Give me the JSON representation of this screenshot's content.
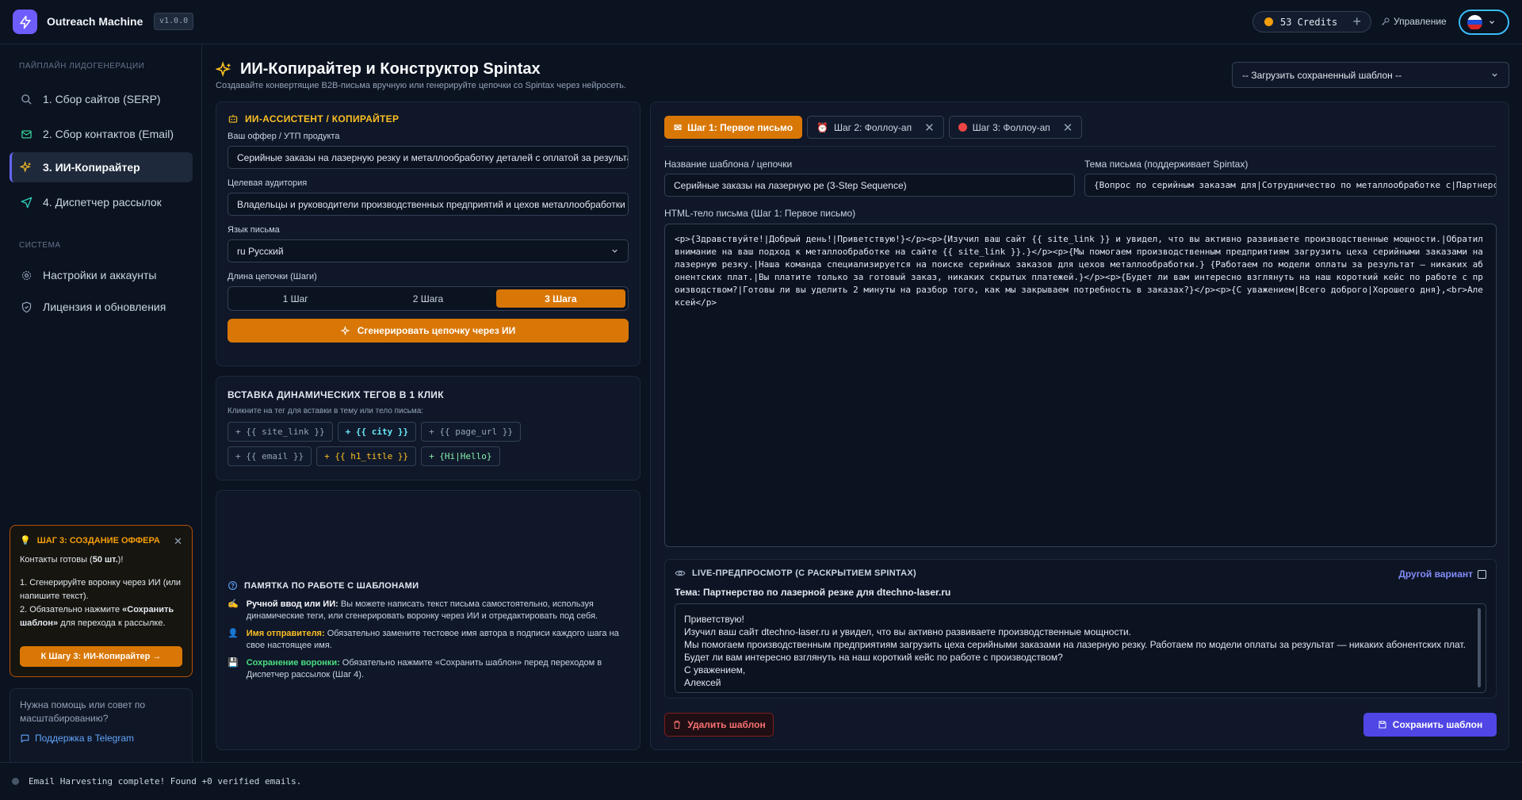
{
  "header": {
    "app_name": "Outreach Machine",
    "version": "v1.0.0",
    "credits": "53 Credits",
    "manage": "Управление",
    "language_flag": "ru"
  },
  "sidebar": {
    "section_pipeline": "ПАЙПЛАЙН ЛИДОГЕНЕРАЦИИ",
    "items": [
      {
        "label": "1. Сбор сайтов (SERP)",
        "icon": "search-icon"
      },
      {
        "label": "2. Сбор контактов (Email)",
        "icon": "mail-icon"
      },
      {
        "label": "3. ИИ-Копирайтер",
        "icon": "sparkles-icon",
        "active": true
      },
      {
        "label": "4. Диспетчер рассылок",
        "icon": "send-icon"
      }
    ],
    "section_system": "СИСТЕМА",
    "system_items": [
      {
        "label": "Настройки и аккаунты",
        "icon": "gear-icon"
      },
      {
        "label": "Лицензия и обновления",
        "icon": "shield-icon"
      }
    ],
    "promo": {
      "title": "ШАГ 3: СОЗДАНИЕ ОФФЕРА",
      "line1_pre": "Контакты готовы (",
      "line1_bold": "50 шт.",
      "line1_post": ")!",
      "line2": "1. Сгенерируйте воронку через ИИ (или напишите текст).",
      "line3_pre": "2. Обязательно нажмите ",
      "line3_bold": "«Сохранить шаблон»",
      "line3_post": " для перехода к рассылке.",
      "button": "К Шагу 3: ИИ-Копирайтер →"
    },
    "help": {
      "text": "Нужна помощь или совет по масштабированию?",
      "link": "Поддержка в Telegram"
    }
  },
  "page": {
    "title": "ИИ-Копирайтер и Конструктор Spintax",
    "subtitle": "Создавайте конвертящие B2B-письма вручную или генерируйте цепочки со Spintax через нейросеть.",
    "template_select": "-- Загрузить сохраненный шаблон --"
  },
  "assistant": {
    "title": "ИИ-АССИСТЕНТ / КОПИРАЙТЕР",
    "offer_label": "Ваш оффер / УТП продукта",
    "offer_value": "Серийные заказы на лазерную резку и металлообработку деталей с оплатой за результат",
    "audience_label": "Целевая аудитория",
    "audience_value": "Владельцы и руководители производственных предприятий и цехов металлообработки",
    "language_label": "Язык письма",
    "language_value": "ru Русский",
    "length_label": "Длина цепочки (Шаги)",
    "length_options": [
      "1 Шаг",
      "2 Шага",
      "3 Шага"
    ],
    "generate_button": "Сгенерировать цепочку через ИИ"
  },
  "tags": {
    "title": "ВСТАВКА ДИНАМИЧЕСКИХ ТЕГОВ В 1 КЛИК",
    "hint": "Кликните на тег для вставки в тему или тело письма:",
    "items": [
      "+ {{ site_link }}",
      "+ {{ city }}",
      "+ {{ page_url }}",
      "+ {{ email }}",
      "+ {{ h1_title }}",
      "+ {Hi|Hello}"
    ]
  },
  "memo": {
    "title": "ПАМЯТКА ПО РАБОТЕ С ШАБЛОНАМИ",
    "items": [
      {
        "bold": "Ручной ввод или ИИ:",
        "text": " Вы можете написать текст письма самостоятельно, используя динамические теги, или сгенерировать воронку через ИИ и отредактировать под себя."
      },
      {
        "bold": "Имя отправителя:",
        "text": " Обязательно замените тестовое имя автора в подписи каждого шага на свое настоящее имя."
      },
      {
        "bold": "Сохранение воронки:",
        "text": " Обязательно нажмите «Сохранить шаблон» перед переходом в Диспетчер рассылок (Шаг 4)."
      }
    ]
  },
  "editor": {
    "steps": [
      "Шаг 1: Первое письмо",
      "Шаг 2: Фоллоу-ап",
      "Шаг 3: Фоллоу-ап"
    ],
    "name_label": "Название шаблона / цепочки",
    "name_value": "Серийные заказы на лазерную ре (3-Step Sequence)",
    "subject_label": "Тема письма (поддерживает Spintax)",
    "subject_value": "{Вопрос по серийным заказам для|Сотрудничество по металлообработке с|Партнерство по лазерной резке для} {{ site_link }}",
    "body_label": "HTML-тело письма (Шаг 1: Первое письмо)",
    "body_value": "<p>{Здравствуйте!|Добрый день!|Приветствую!}</p><p>{Изучил ваш сайт {{ site_link }} и увидел, что вы активно развиваете производственные мощности.|Обратил внимание на ваш подход к металлообработке на сайте {{ site_link }}.}</p><p>{Мы помогаем производственным предприятиям загрузить цеха серийными заказами на лазерную резку.|Наша команда специализируется на поиске серийных заказов для цехов металлообработки.} {Работаем по модели оплаты за результат — никаких абонентских плат.|Вы платите только за готовый заказ, никаких скрытых платежей.}</p><p>{Будет ли вам интересно взглянуть на наш короткий кейс по работе с производством?|Готовы ли вы уделить 2 минуты на разбор того, как мы закрываем потребность в заказах?}</p><p>{С уважением|Всего доброго|Хорошего дня},<br>Алексей</p>"
  },
  "preview": {
    "title": "LIVE-ПРЕДПРОСМОТР (С РАСКРЫТИЕМ SPINTAX)",
    "other_variant": "Другой вариант",
    "subject": "Тема: Партнерство по лазерной резке для dtechno-laser.ru",
    "lines": [
      "Приветствую!",
      "Изучил ваш сайт dtechno-laser.ru и увидел, что вы активно развиваете производственные мощности.",
      "Мы помогаем производственным предприятиям загрузить цеха серийными заказами на лазерную резку. Работаем по модели оплаты за результат — никаких абонентских плат.",
      "Будет ли вам интересно взглянуть на наш короткий кейс по работе с производством?",
      "С уважением,",
      "Алексей"
    ]
  },
  "actions": {
    "delete": "Удалить шаблон",
    "save": "Сохранить шаблон"
  },
  "status": {
    "text": "Email Harvesting complete! Found +0 verified emails."
  },
  "colors": {
    "accent_orange": "#d97706",
    "accent_indigo": "#4f46e5",
    "danger": "#f87171",
    "background": "#0b1220"
  }
}
